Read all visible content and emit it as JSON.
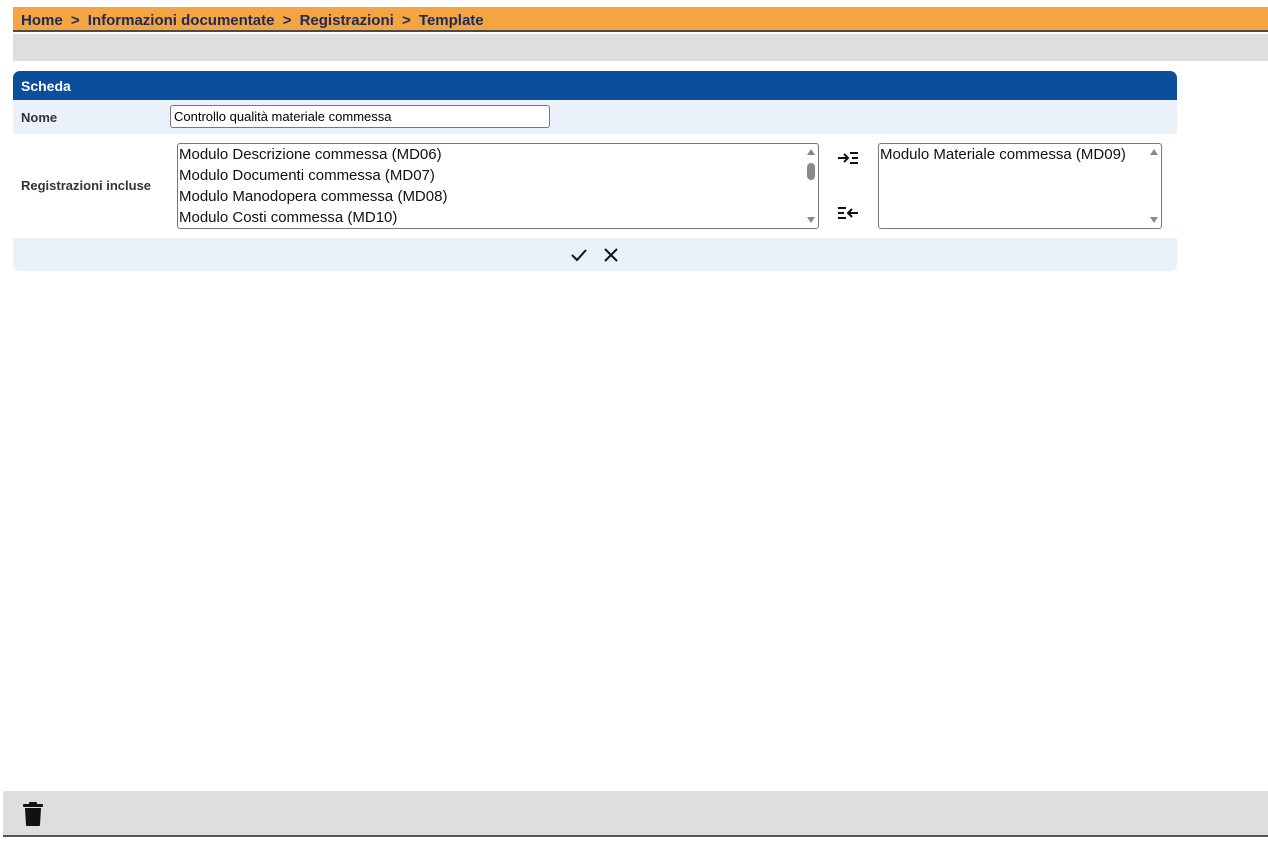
{
  "breadcrumb": {
    "items": [
      "Home",
      "Informazioni documentate",
      "Registrazioni",
      "Template"
    ],
    "separator": ">"
  },
  "card": {
    "title": "Scheda",
    "nome": {
      "label": "Nome",
      "value": "Controllo qualità materiale commessa"
    },
    "registrazioni": {
      "label": "Registrazioni incluse",
      "available": [
        "Modulo Descrizione commessa (MD06)",
        "Modulo Documenti commessa (MD07)",
        "Modulo Manodopera commessa (MD08)",
        "Modulo Costi commessa (MD10)"
      ],
      "selected": [
        "Modulo Materiale commessa (MD09)"
      ],
      "add_icon": "move-to-list-icon",
      "remove_icon": "move-from-list-icon"
    },
    "actions": {
      "confirm_icon": "check-icon",
      "cancel_icon": "close-icon"
    }
  },
  "bottom_toolbar": {
    "delete_icon": "trash-icon"
  },
  "colors": {
    "breadcrumb_bg": "#f4a541",
    "breadcrumb_text": "#1b2a5a",
    "card_header": "#0b4f9c",
    "card_row_bg": "#eaf1fb",
    "toolbar_bg": "#dedede"
  }
}
